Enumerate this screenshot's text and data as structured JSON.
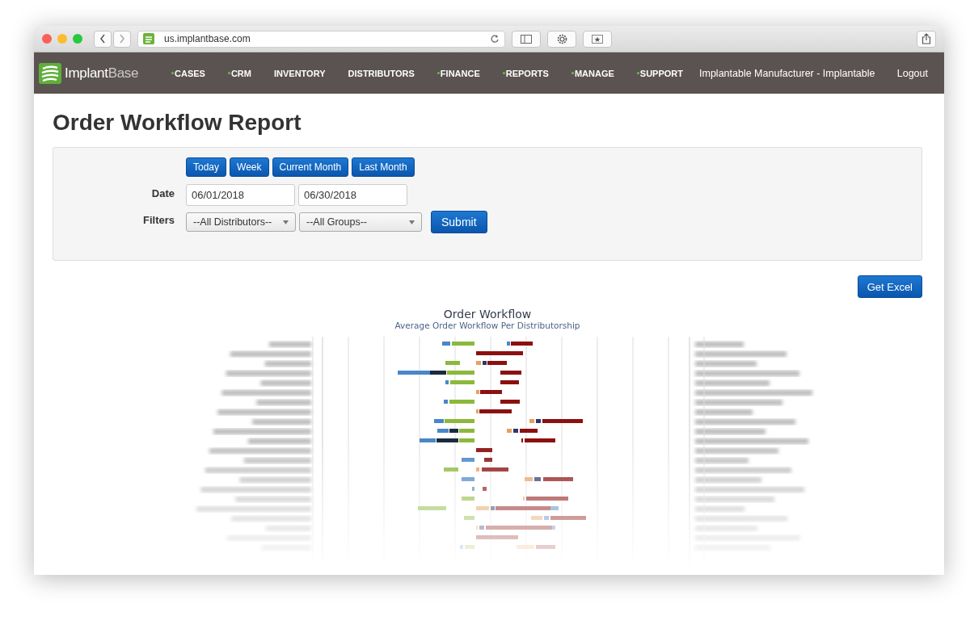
{
  "browser": {
    "url": "us.implantbase.com"
  },
  "nav": {
    "logo": {
      "main": "Implant",
      "accent": "Base"
    },
    "items": [
      {
        "label": "CASES",
        "marker": true
      },
      {
        "label": "CRM",
        "marker": true
      },
      {
        "label": "INVENTORY",
        "marker": false
      },
      {
        "label": "DISTRIBUTORS",
        "marker": false
      },
      {
        "label": "FINANCE",
        "marker": true
      },
      {
        "label": "REPORTS",
        "marker": true
      },
      {
        "label": "MANAGE",
        "marker": true
      },
      {
        "label": "SUPPORT",
        "marker": true
      }
    ],
    "account": "Implantable Manufacturer - Implantable",
    "logout": "Logout"
  },
  "page_title": "Order Workflow Report",
  "filters": {
    "quick_ranges": [
      "Today",
      "Week",
      "Current Month",
      "Last Month"
    ],
    "date_label": "Date",
    "date_from": "06/01/2018",
    "date_to": "06/30/2018",
    "filters_label": "Filters",
    "distributor": "--All Distributors--",
    "group": "--All Groups--",
    "submit": "Submit"
  },
  "export_button": "Get Excel",
  "chart": {
    "title": "Order Workflow",
    "subtitle": "Average Order Workflow Per Distributorship",
    "kind": "picture"
  }
}
